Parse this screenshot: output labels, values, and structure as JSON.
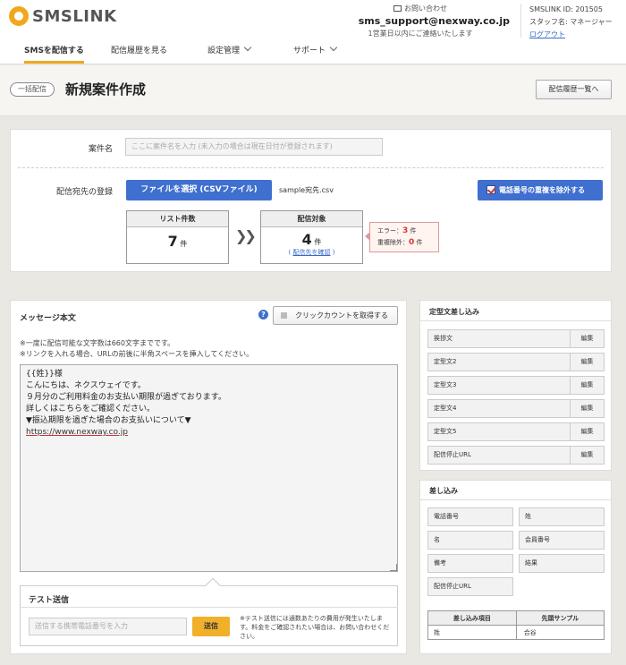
{
  "header": {
    "logo_text": "SMSLINK",
    "contact_label": "お問い合わせ",
    "support_email": "sms_support@nexway.co.jp",
    "support_hours": "1営業日以内にご連絡いたします",
    "account_id": "SMSLINK ID: 201505",
    "staff_name": "スタッフ名: マネージャー",
    "logout": "ログアウト"
  },
  "nav": {
    "send": "SMSを配信する",
    "history": "配信履歴を見る",
    "settings": "設定管理",
    "support": "サポート"
  },
  "titlebar": {
    "badge": "一括配信",
    "title": "新規案件作成",
    "list_button": "配信履歴一覧へ"
  },
  "form": {
    "case_label": "案件名",
    "case_placeholder": "ここに案件名を入力 (未入力の場合は現在日付が登録されます)",
    "dest_label": "配信宛先の登録",
    "file_button": "ファイルを選択 (CSVファイル)",
    "filename": "sample宛先.csv",
    "exclude_button": "電話番号の重複を除外する",
    "list_count_label": "リスト件数",
    "list_count": "7",
    "count_unit": "件",
    "target_label": "配信対象",
    "target_count": "4",
    "confirm_link": "配信先を確認",
    "error_label": "エラー：",
    "error_count": "3",
    "dup_label": "重複除外：",
    "dup_count": "0"
  },
  "message": {
    "title": "メッセージ本文",
    "help": "?",
    "click_count_button": "クリックカウントを取得する",
    "note1": "※一度に配信可能な文字数は660文字までです。",
    "note2": "※リンクを入れる場合、URLの前後に半角スペースを挿入してください。",
    "lines": [
      "{{姓}}様",
      "こんにちは、ネクスウェイです。",
      "９月分のご利用料金のお支払い期限が過ぎております。",
      "詳しくはこちらをご確認ください。",
      "▼振込期限を過ぎた場合のお支払いについて▼"
    ],
    "url": "https://www.nexway.co.jp"
  },
  "test": {
    "title": "テスト送信",
    "placeholder": "送信する携帯電話番号を入力",
    "send_button": "送信",
    "note": "※テスト送信には通数あたりの費用が発生いたします。料金をご確認されたい場合は、お問い合わせください。"
  },
  "templates": {
    "title": "定型文差し込み",
    "edit_label": "編集",
    "items": [
      "挨拶文",
      "定型文2",
      "定型文3",
      "定型文4",
      "定型文5",
      "配信停止URL"
    ]
  },
  "substitution": {
    "title": "差し込み",
    "buttons": [
      "電話番号",
      "姓",
      "名",
      "会員番号",
      "備考",
      "結果",
      "配信停止URL"
    ],
    "table_headers": [
      "差し込み項目",
      "先頭サンプル"
    ],
    "table_row": [
      "姓",
      "合谷"
    ]
  }
}
